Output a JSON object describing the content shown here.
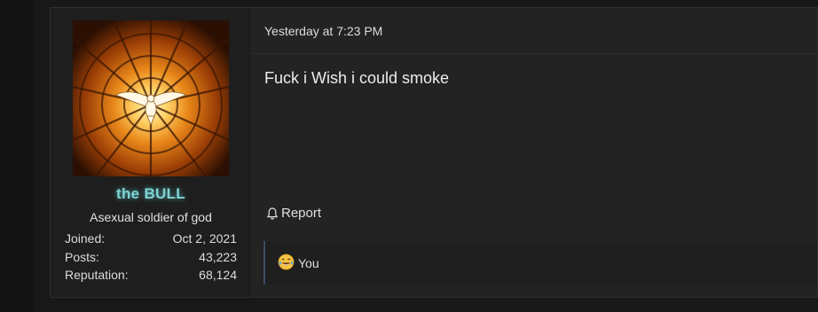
{
  "post": {
    "user": {
      "username": "the BULL",
      "user_title": "Asexual soldier of god",
      "avatar": "holy-spirit-dove-stained-glass",
      "stats": [
        {
          "label": "Joined:",
          "value": "Oct 2, 2021"
        },
        {
          "label": "Posts:",
          "value": "43,223"
        },
        {
          "label": "Reputation:",
          "value": "68,124"
        }
      ]
    },
    "timestamp": "Yesterday at 7:23 PM",
    "content": "Fuck i Wish i could smoke",
    "report_label": "Report",
    "reactions": {
      "emoji": "laughing-tears-emoji",
      "text": "You"
    }
  },
  "colors": {
    "username": "#7fd4d4",
    "reaction_border": "#3a4e66"
  }
}
